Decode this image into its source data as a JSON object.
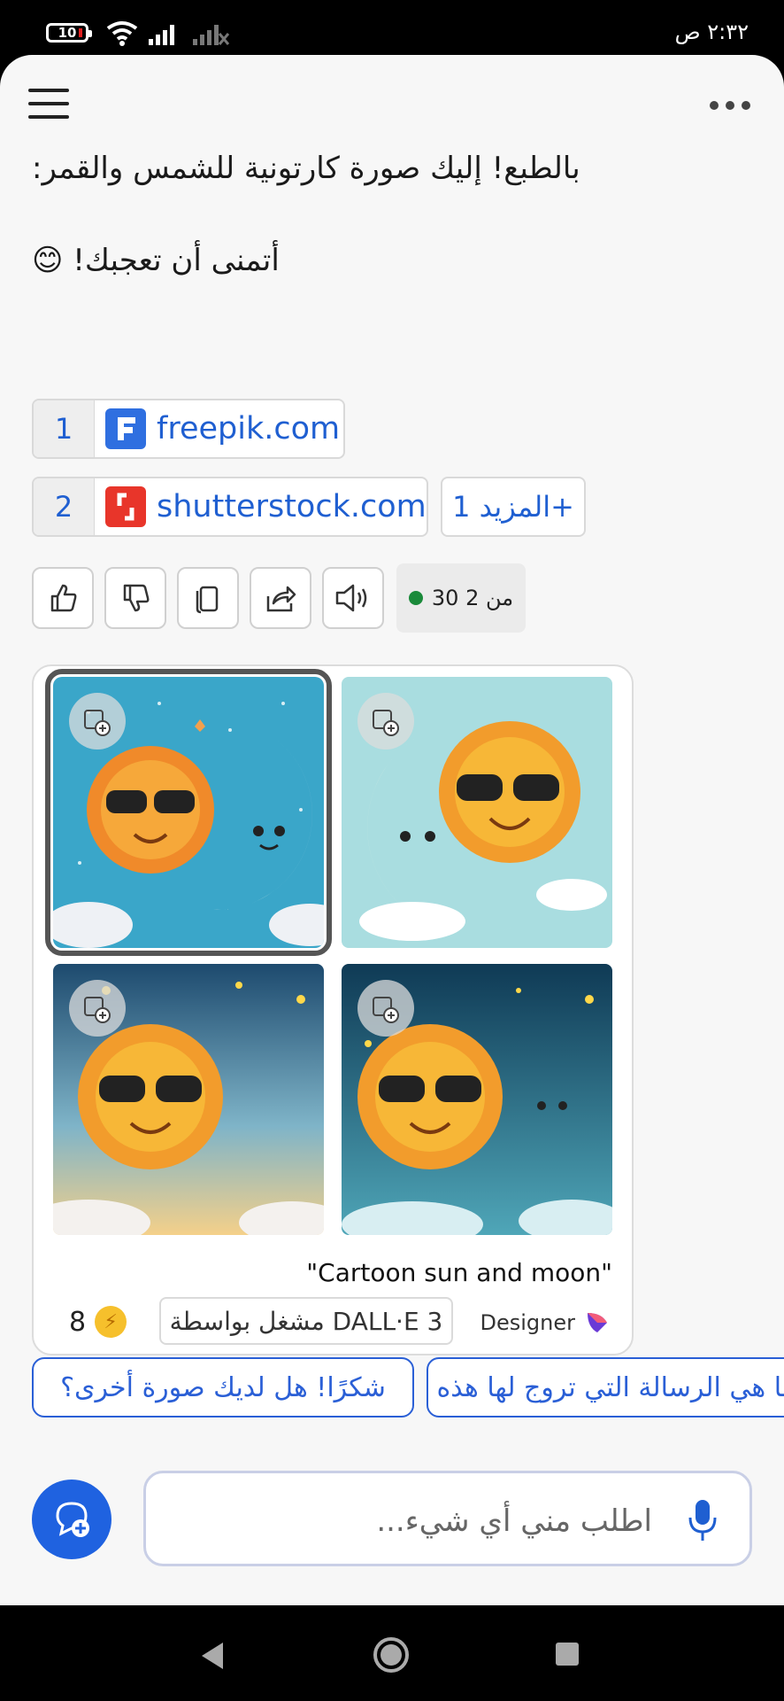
{
  "status": {
    "time": "٢:٣٢ ص",
    "battery": "10"
  },
  "chat": {
    "line1": "بالطبع! إليك صورة كارتونية للشمس والقمر:",
    "line2": "أتمنى أن تعجبك! 😊"
  },
  "citations": [
    {
      "num": "1",
      "domain": "freepik.com",
      "color": "#2f6fe0"
    },
    {
      "num": "2",
      "domain": "shutterstock.com",
      "color": "#e8352a"
    }
  ],
  "more_citations": "المزيد 1+",
  "actions": [
    "like-icon",
    "dislike-icon",
    "copy-icon",
    "share-icon",
    "speaker-icon"
  ],
  "counter": "30 من 2",
  "image_card": {
    "caption": "\"Cartoon sun and moon\"",
    "powered_by": "مشغل بواسطة DALL·E 3",
    "designer_label": "Designer",
    "boosts": "8"
  },
  "suggestions": [
    "شكرًا! هل لديك صورة أخرى؟",
    "ما هي الرسالة التي تروج لها هذه الصورة؟"
  ],
  "input": {
    "placeholder": "اطلب مني أي شيء..."
  }
}
